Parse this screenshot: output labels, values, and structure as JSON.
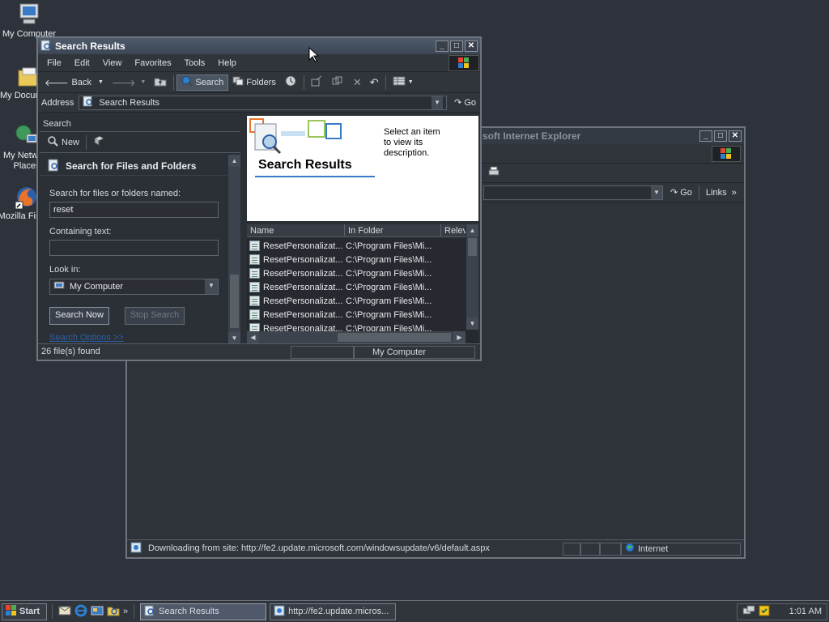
{
  "desktop": {
    "icons": [
      {
        "label": "My Computer",
        "icon": "my-computer-icon"
      },
      {
        "label": "My Documents",
        "icon": "folder-icon"
      },
      {
        "label": "My Network Places",
        "icon": "network-icon"
      },
      {
        "label": "Mozilla Firefox",
        "icon": "firefox-icon"
      }
    ]
  },
  "search_window": {
    "title": "Search Results",
    "menu": [
      "File",
      "Edit",
      "View",
      "Favorites",
      "Tools",
      "Help"
    ],
    "toolbar": {
      "back": "Back",
      "search": "Search",
      "folders": "Folders"
    },
    "address_label": "Address",
    "address_value": "Search Results",
    "go": "Go",
    "pane": {
      "title": "Search",
      "new": "New",
      "heading": "Search for Files and Folders",
      "name_label": "Search for files or folders named:",
      "name_value": "reset",
      "contain_label": "Containing text:",
      "contain_value": "",
      "lookin_label": "Look in:",
      "lookin_value": "My Computer",
      "search_now": "Search Now",
      "stop_search": "Stop Search",
      "options_link": "Search Options >>"
    },
    "results_header": {
      "title": "Search Results",
      "hint": "Select an item to view its description."
    },
    "columns": [
      "Name",
      "In Folder",
      "Relev"
    ],
    "rows": [
      {
        "name": "ResetPersonalizat...",
        "folder": "C:\\Program Files\\Mi..."
      },
      {
        "name": "ResetPersonalizat...",
        "folder": "C:\\Program Files\\Mi..."
      },
      {
        "name": "ResetPersonalizat...",
        "folder": "C:\\Program Files\\Mi..."
      },
      {
        "name": "ResetPersonalizat...",
        "folder": "C:\\Program Files\\Mi..."
      },
      {
        "name": "ResetPersonalizat...",
        "folder": "C:\\Program Files\\Mi..."
      },
      {
        "name": "ResetPersonalizat...",
        "folder": "C:\\Program Files\\Mi..."
      },
      {
        "name": "ResetPersonalizat...",
        "folder": "C:\\Program Files\\Mi..."
      }
    ],
    "status": {
      "count": "26 file(s) found",
      "location": "My Computer"
    }
  },
  "ie_window": {
    "title_fragment": "soft Internet Explorer",
    "go": "Go",
    "links": "Links",
    "status_text": "Downloading from site: http://fe2.update.microsoft.com/windowsupdate/v6/default.aspx",
    "zone": "Internet"
  },
  "taskbar": {
    "start": "Start",
    "tasks": [
      "Search Results",
      "http://fe2.update.micros..."
    ],
    "clock": "1:01 AM"
  }
}
